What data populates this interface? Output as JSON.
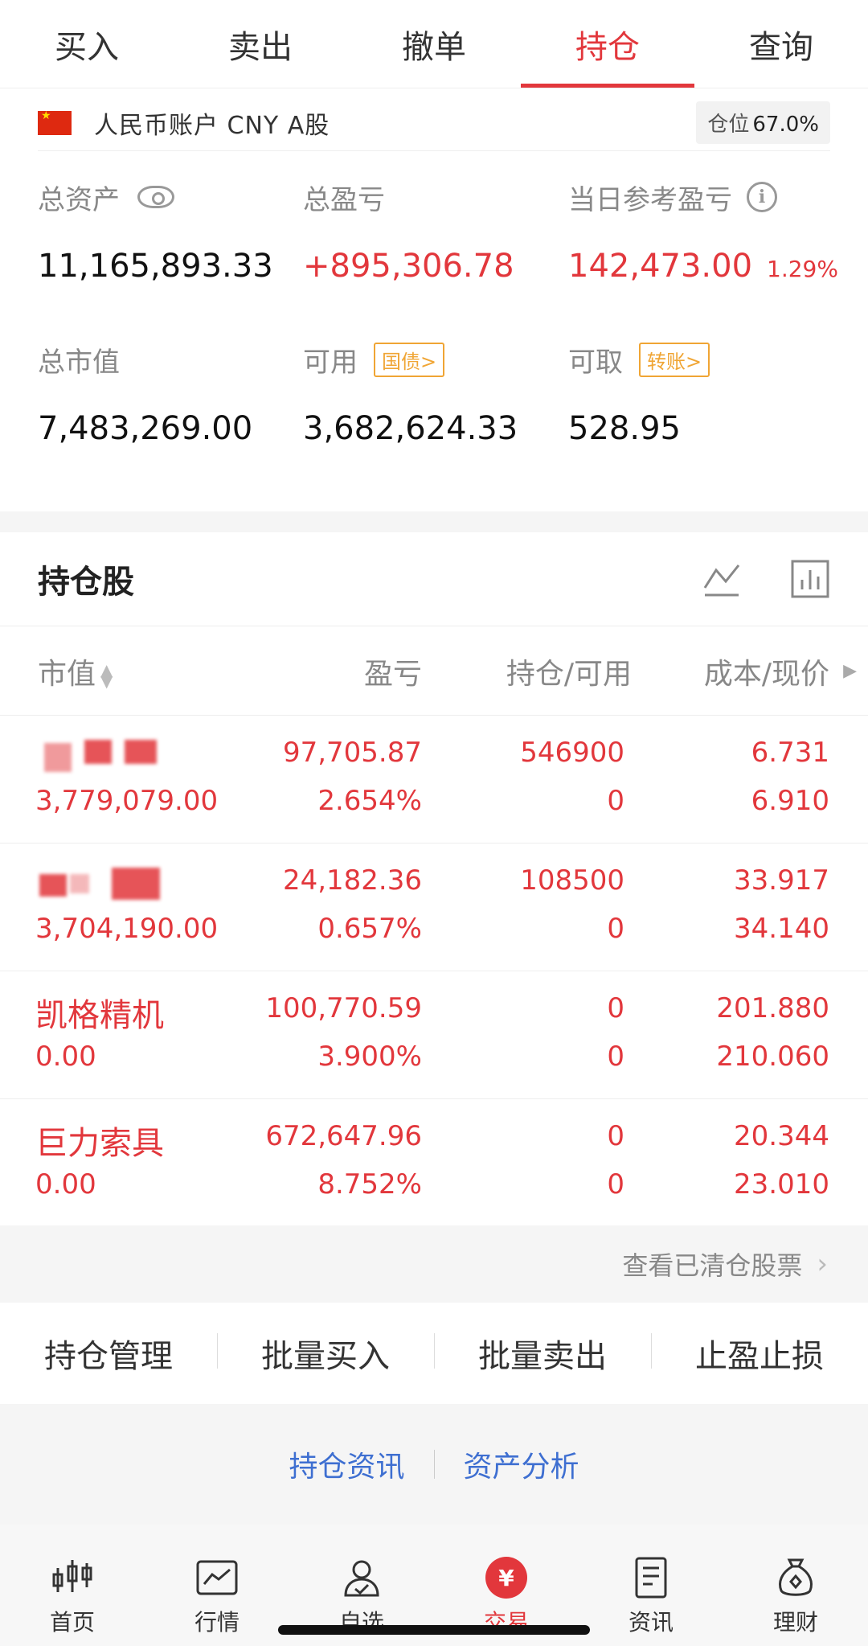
{
  "tabs": [
    {
      "label": "买入",
      "active": false
    },
    {
      "label": "卖出",
      "active": false
    },
    {
      "label": "撤单",
      "active": false
    },
    {
      "label": "持仓",
      "active": true
    },
    {
      "label": "查询",
      "active": false
    }
  ],
  "account": {
    "label": "人民币账户 CNY A股",
    "position_label": "仓位",
    "position_value": "67.0%"
  },
  "summary": {
    "total_assets_label": "总资产",
    "total_assets": "11,165,893.33",
    "total_pnl_label": "总盈亏",
    "total_pnl": "+895,306.78",
    "daily_pnl_label": "当日参考盈亏",
    "daily_pnl": "142,473.00",
    "daily_pnl_pct": "1.29%",
    "market_value_label": "总市值",
    "market_value": "7,483,269.00",
    "available_label": "可用",
    "available_tag": "国债>",
    "available": "3,682,624.33",
    "withdrawable_label": "可取",
    "withdrawable_tag": "转账>",
    "withdrawable": "528.95"
  },
  "holdings": {
    "title": "持仓股",
    "columns": {
      "market_value": "市值",
      "pnl": "盈亏",
      "position": "持仓/可用",
      "cost": "成本/现价"
    },
    "rows": [
      {
        "name": "",
        "market_value": "3,779,079.00",
        "pnl": "97,705.87",
        "pnl_pct": "2.654%",
        "position": "546900",
        "available": "0",
        "cost": "6.731",
        "price": "6.910"
      },
      {
        "name": "",
        "market_value": "3,704,190.00",
        "pnl": "24,182.36",
        "pnl_pct": "0.657%",
        "position": "108500",
        "available": "0",
        "cost": "33.917",
        "price": "34.140"
      },
      {
        "name": "凯格精机",
        "market_value": "0.00",
        "pnl": "100,770.59",
        "pnl_pct": "3.900%",
        "position": "0",
        "available": "0",
        "cost": "201.880",
        "price": "210.060"
      },
      {
        "name": "巨力索具",
        "market_value": "0.00",
        "pnl": "672,647.96",
        "pnl_pct": "8.752%",
        "position": "0",
        "available": "0",
        "cost": "20.344",
        "price": "23.010"
      }
    ]
  },
  "cleared_link": "查看已清仓股票",
  "actions": [
    "持仓管理",
    "批量买入",
    "批量卖出",
    "止盈止损"
  ],
  "info_links": [
    "持仓资讯",
    "资产分析"
  ],
  "bottom_nav": [
    {
      "label": "首页",
      "icon": "candlestick-icon"
    },
    {
      "label": "行情",
      "icon": "chart-icon"
    },
    {
      "label": "自选",
      "icon": "user-check-icon"
    },
    {
      "label": "交易",
      "icon": "yuan-icon",
      "active": true
    },
    {
      "label": "资讯",
      "icon": "document-icon"
    },
    {
      "label": "理财",
      "icon": "money-bag-icon"
    }
  ],
  "colors": {
    "accent": "#e2373c",
    "tag": "#f0a534",
    "link": "#3e6fd1"
  }
}
